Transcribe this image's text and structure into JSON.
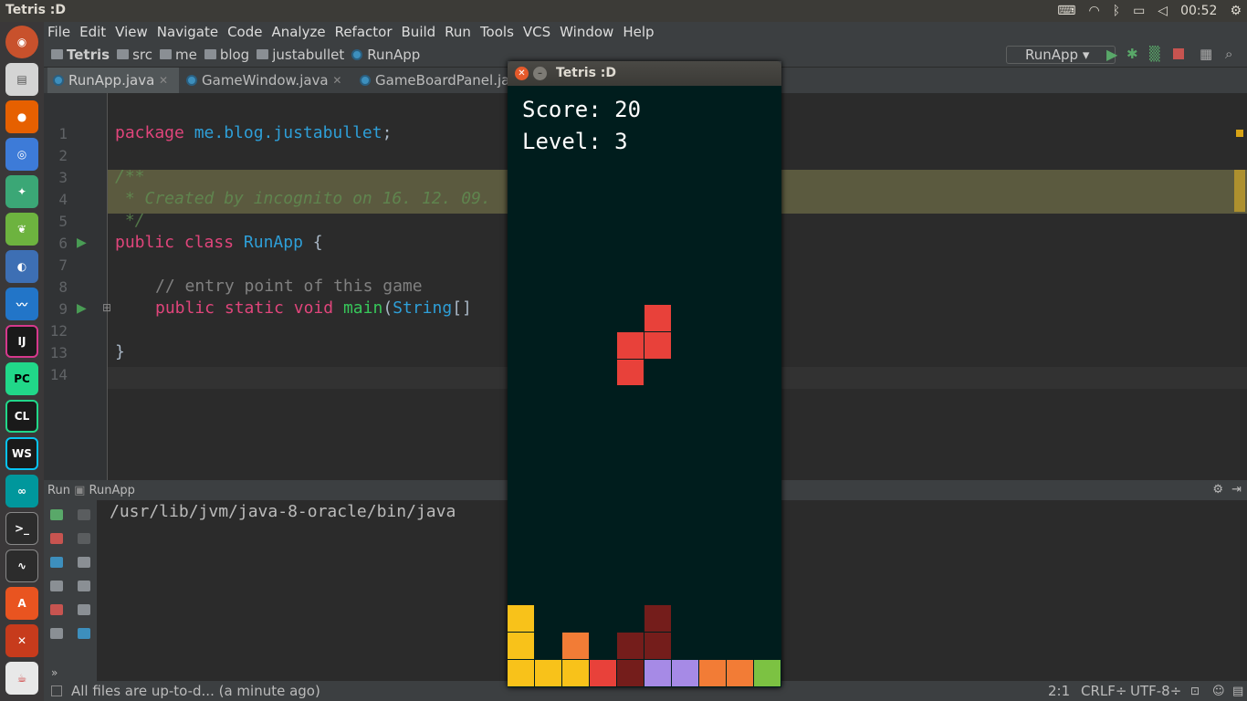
{
  "topbar": {
    "title": "Tetris :D",
    "time": "00:52"
  },
  "menu": [
    "File",
    "Edit",
    "View",
    "Navigate",
    "Code",
    "Analyze",
    "Refactor",
    "Build",
    "Run",
    "Tools",
    "VCS",
    "Window",
    "Help"
  ],
  "nav": {
    "crumbs": [
      "Tetris",
      "src",
      "me",
      "blog",
      "justabullet",
      "RunApp"
    ],
    "run_config": "RunApp"
  },
  "tabs": [
    "RunApp.java",
    "GameWindow.java",
    "GameBoardPanel.ja"
  ],
  "editor": {
    "line_numbers": [
      "1",
      "2",
      "3",
      "4",
      "5",
      "6",
      "7",
      "8",
      "9",
      "12",
      "13",
      "14"
    ],
    "l1": {
      "kw": "package",
      "pkg": "me.blog.justabullet",
      "semi": ";"
    },
    "l3": "/**",
    "l4": " * Created by incognito on 16. 12. 09.",
    "l5": " */",
    "l6": {
      "kw1": "public",
      "kw2": "class",
      "name": "RunApp",
      "brace": "{"
    },
    "l8": "// entry point of this game",
    "l9": {
      "kw1": "public",
      "kw2": "static",
      "kw3": "void",
      "fn": "main",
      "paren": "(",
      "type": "String",
      "rest": "[]"
    },
    "l13": "}"
  },
  "run": {
    "label": "Run",
    "config": "RunApp",
    "output": "/usr/lib/jvm/java-8-oracle/bin/java"
  },
  "status": {
    "message": "All files are up-to-d... (a minute ago)",
    "position": "2:1",
    "line_sep": "CRLF÷",
    "encoding": "UTF-8÷"
  },
  "tetris": {
    "window_title": "Tetris :D",
    "score_label": "Score:",
    "score": "20",
    "level_label": "Level:",
    "level": "3",
    "colors": {
      "red": "#e8413a",
      "yellow": "#f8c21a",
      "orange": "#f27c36",
      "darkred": "#741d1b",
      "purple": "#a68ae6",
      "green": "#7cc242"
    },
    "grid": {
      "cols": 10,
      "rows": 22
    },
    "falling_piece": [
      [
        5,
        8
      ],
      [
        4,
        9
      ],
      [
        5,
        9
      ],
      [
        4,
        10
      ]
    ],
    "stack": [
      {
        "c": 0,
        "r": 19,
        "color": "yellow"
      },
      {
        "c": 0,
        "r": 20,
        "color": "yellow"
      },
      {
        "c": 0,
        "r": 21,
        "color": "yellow"
      },
      {
        "c": 1,
        "r": 21,
        "color": "yellow"
      },
      {
        "c": 2,
        "r": 21,
        "color": "yellow"
      },
      {
        "c": 2,
        "r": 20,
        "color": "orange"
      },
      {
        "c": 3,
        "r": 21,
        "color": "red"
      },
      {
        "c": 4,
        "r": 21,
        "color": "darkred"
      },
      {
        "c": 4,
        "r": 20,
        "color": "darkred"
      },
      {
        "c": 5,
        "r": 20,
        "color": "darkred"
      },
      {
        "c": 5,
        "r": 19,
        "color": "darkred"
      },
      {
        "c": 5,
        "r": 21,
        "color": "purple"
      },
      {
        "c": 6,
        "r": 21,
        "color": "purple"
      },
      {
        "c": 7,
        "r": 21,
        "color": "orange"
      },
      {
        "c": 8,
        "r": 21,
        "color": "orange"
      },
      {
        "c": 9,
        "r": 21,
        "color": "green"
      }
    ]
  },
  "launcher": [
    "ubuntu-icon",
    "files-icon",
    "firefox-icon",
    "chromium-icon",
    "android-studio-icon",
    "spring-icon",
    "eclipse-icon",
    "monitor-icon",
    "intellij-icon",
    "pycharm-icon",
    "clion-icon",
    "webstorm-icon",
    "arduino-icon",
    "terminal-icon",
    "system-monitor-icon",
    "software-center-icon",
    "settings-icon",
    "java-icon"
  ]
}
